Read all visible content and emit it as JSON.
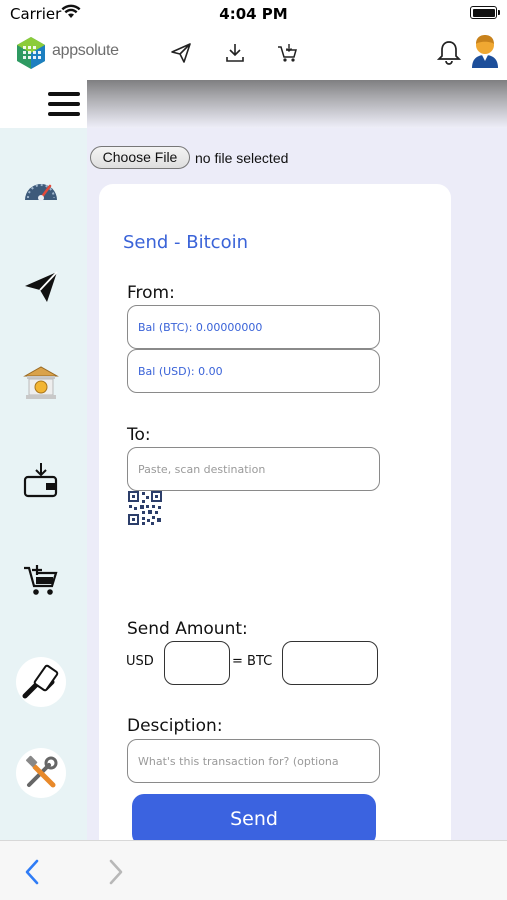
{
  "status_bar": {
    "carrier": "Carrier",
    "time": "4:04 PM"
  },
  "header": {
    "brand": "appsolute"
  },
  "file_input": {
    "button_label": "Choose File",
    "status_text": "no file selected"
  },
  "form": {
    "title": "Send - Bitcoin",
    "from_label": "From:",
    "bal_btc": "Bal (BTC): 0.00000000",
    "bal_usd": "Bal (USD): 0.00",
    "to_label": "To:",
    "to_placeholder": "Paste, scan destination",
    "amount_label": "Send Amount:",
    "usd_label": "USD",
    "btc_label": "= BTC",
    "desc_label": "Desciption:",
    "desc_placeholder": "What's this transaction for? (optiona",
    "send_label": "Send"
  },
  "colors": {
    "accent": "#3b63e0",
    "sidebar_bg": "#e8f3f5",
    "main_bg": "#ececf8"
  }
}
